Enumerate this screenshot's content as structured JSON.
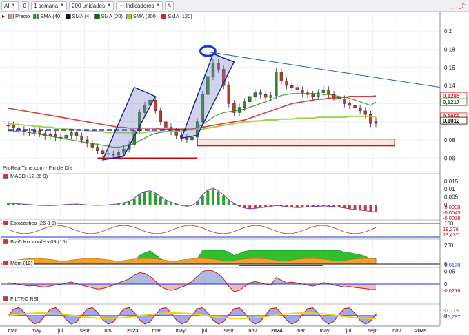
{
  "toolbar": {
    "symbol": "AI",
    "interval": "1 semana",
    "units": "200 unidades",
    "indicators": "Indicadores",
    "zero_btn": "0"
  },
  "legend": [
    {
      "label": "Precio",
      "color": "#f08a8a"
    },
    {
      "label": "SMA (40)",
      "color": "#2e8b2e"
    },
    {
      "label": "SMA (4)",
      "color": "#111111"
    },
    {
      "label": "SMA (20)",
      "color": "#1f5f1f"
    },
    {
      "label": "SMA (200)",
      "color": "#9acd32"
    },
    {
      "label": "SMA (120)",
      "color": "#d62728"
    }
  ],
  "source_text": "ProRealTime.com - Fin de Día",
  "x_axis_labels": [
    "mar",
    "may",
    "jul",
    "sept",
    "nov",
    "2023",
    "mar",
    "may",
    "jul",
    "sept",
    "nov",
    "2024",
    "mar",
    "may",
    "jul",
    "sept",
    "nov",
    "2025"
  ],
  "chart_data": [
    {
      "type": "line",
      "title": "",
      "y_ticks": [
        "0,2",
        "0,18",
        "0,16",
        "0,14",
        "0,12",
        "0,1",
        "0,08",
        "0,06"
      ],
      "ylim": [
        0.045,
        0.21
      ],
      "price_labels": [
        {
          "text": "0,1285",
          "color": "#d62728"
        },
        {
          "text": "0,1217",
          "color": "#1f5f1f"
        },
        {
          "text": "0,1059",
          "color": "#d62728"
        },
        {
          "text": "0,1012",
          "color": "#111111"
        }
      ],
      "series": [
        {
          "name": "Precio",
          "color": "#2e8b2e",
          "values": [
            0.096,
            0.093,
            0.091,
            0.089,
            0.088,
            0.09,
            0.087,
            0.084,
            0.086,
            0.083,
            0.082,
            0.085,
            0.088,
            0.084,
            0.08,
            0.076,
            0.072,
            0.068,
            0.065,
            0.064,
            0.063,
            0.066,
            0.07,
            0.075,
            0.09,
            0.11,
            0.118,
            0.124,
            0.112,
            0.1,
            0.094,
            0.089,
            0.085,
            0.082,
            0.08,
            0.083,
            0.1,
            0.13,
            0.15,
            0.165,
            0.158,
            0.14,
            0.12,
            0.11,
            0.116,
            0.122,
            0.128,
            0.132,
            0.13,
            0.127,
            0.129,
            0.155,
            0.145,
            0.14,
            0.138,
            0.135,
            0.132,
            0.13,
            0.128,
            0.132,
            0.135,
            0.13,
            0.127,
            0.125,
            0.12,
            0.118,
            0.115,
            0.112,
            0.108,
            0.098,
            0.101
          ]
        },
        {
          "name": "SMA (40)",
          "color": "#2e8b2e",
          "values": [
            0.09,
            0.09,
            0.089,
            0.089,
            0.088,
            0.087,
            0.086,
            0.085,
            0.084,
            0.083,
            0.082,
            0.081,
            0.08,
            0.079,
            0.078,
            0.077,
            0.076,
            0.075,
            0.074,
            0.073,
            0.072,
            0.072,
            0.073,
            0.074,
            0.076,
            0.079,
            0.082,
            0.085,
            0.087,
            0.088,
            0.089,
            0.089,
            0.09,
            0.09,
            0.091,
            0.092,
            0.094,
            0.097,
            0.101,
            0.105,
            0.108,
            0.11,
            0.111,
            0.112,
            0.113,
            0.114,
            0.116,
            0.118,
            0.12,
            0.122,
            0.124,
            0.127,
            0.129,
            0.13,
            0.131,
            0.131,
            0.131,
            0.131,
            0.131,
            0.131,
            0.13,
            0.13,
            0.129,
            0.128,
            0.127,
            0.126,
            0.124,
            0.122,
            0.12,
            0.118,
            0.1217
          ]
        },
        {
          "name": "SMA (120)",
          "color": "#d62728",
          "values": [
            0.115,
            0.114,
            0.113,
            0.112,
            0.111,
            0.11,
            0.109,
            0.108,
            0.107,
            0.106,
            0.105,
            0.104,
            0.103,
            0.102,
            0.101,
            0.1,
            0.099,
            0.098,
            0.097,
            0.096,
            0.095,
            0.094,
            0.094,
            0.093,
            0.093,
            0.093,
            0.093,
            0.093,
            0.093,
            0.092,
            0.092,
            0.092,
            0.092,
            0.092,
            0.092,
            0.092,
            0.093,
            0.094,
            0.095,
            0.096,
            0.097,
            0.098,
            0.099,
            0.1,
            0.101,
            0.102,
            0.104,
            0.106,
            0.108,
            0.11,
            0.112,
            0.114,
            0.116,
            0.118,
            0.12,
            0.121,
            0.122,
            0.123,
            0.124,
            0.125,
            0.125,
            0.126,
            0.126,
            0.127,
            0.127,
            0.128,
            0.128,
            0.128,
            0.128,
            0.128,
            0.1285
          ]
        },
        {
          "name": "SMA (200)",
          "color": "#9acd32",
          "values": [
            0.098,
            0.097,
            0.097,
            0.096,
            0.096,
            0.095,
            0.095,
            0.094,
            0.094,
            0.093,
            0.093,
            0.092,
            0.092,
            0.091,
            0.091,
            0.09,
            0.09,
            0.089,
            0.089,
            0.088,
            0.088,
            0.088,
            0.088,
            0.088,
            0.088,
            0.088,
            0.088,
            0.089,
            0.089,
            0.089,
            0.089,
            0.09,
            0.09,
            0.09,
            0.091,
            0.091,
            0.092,
            0.092,
            0.093,
            0.094,
            0.095,
            0.096,
            0.097,
            0.098,
            0.099,
            0.1,
            0.1,
            0.101,
            0.101,
            0.102,
            0.102,
            0.102,
            0.103,
            0.103,
            0.103,
            0.104,
            0.104,
            0.104,
            0.104,
            0.105,
            0.105,
            0.105,
            0.105,
            0.105,
            0.105,
            0.106,
            0.106,
            0.106,
            0.106,
            0.106,
            0.1059
          ]
        }
      ]
    },
    {
      "type": "bar",
      "title": "MACD (12 26 9)",
      "y_ticks": [
        "0,015",
        "0,01",
        "0,005",
        "0"
      ],
      "last_values": [
        "-0,0038",
        "-0,0043",
        "-0,0078"
      ],
      "values": [
        0.001,
        0.0008,
        0.0005,
        0.0003,
        0.0001,
        -0.0002,
        -0.0004,
        -0.0005,
        -0.0006,
        -0.0004,
        -0.0002,
        0.0001,
        0.0003,
        0.0004,
        0.0002,
        -0.0001,
        -0.0003,
        -0.0004,
        -0.0003,
        -0.0001,
        0.0002,
        0.0006,
        0.0012,
        0.002,
        0.004,
        0.0065,
        0.008,
        0.0085,
        0.0072,
        0.005,
        0.003,
        0.0015,
        0.0005,
        -0.0005,
        -0.001,
        -0.0005,
        0.002,
        0.006,
        0.009,
        0.01,
        0.0085,
        0.006,
        0.003,
        0.0008,
        -0.001,
        -0.002,
        -0.0025,
        -0.0022,
        -0.0018,
        -0.0015,
        -0.001,
        -0.0005,
        -0.0008,
        -0.0012,
        -0.0015,
        -0.0018,
        -0.0016,
        -0.0014,
        -0.0012,
        -0.001,
        -0.0008,
        -0.001,
        -0.0012,
        -0.0015,
        -0.002,
        -0.0025,
        -0.003,
        -0.0033,
        -0.0036,
        -0.004,
        -0.0043
      ]
    },
    {
      "type": "line",
      "title": "Estocástico (26 8 5)",
      "y_ticks": [
        "100"
      ],
      "last_values": [
        "19,276",
        "13,437"
      ],
      "values": []
    },
    {
      "type": "area",
      "title": "Blai5 Koncorde v.09 (15)",
      "y_ticks": [
        "200",
        "0"
      ],
      "last_values": [
        "-5,0178"
      ],
      "values": []
    },
    {
      "type": "area",
      "title": "Mom (12)",
      "y_ticks": [
        "0,05",
        "0"
      ],
      "last_values": [
        "-0,0216"
      ],
      "values": [
        0.005,
        0.003,
        -0.002,
        -0.005,
        -0.008,
        -0.006,
        -0.01,
        -0.012,
        -0.008,
        -0.004,
        -0.002,
        0.004,
        0.008,
        0.002,
        -0.005,
        -0.01,
        -0.015,
        -0.02,
        -0.018,
        -0.012,
        -0.005,
        0.005,
        0.012,
        0.02,
        0.035,
        0.045,
        0.042,
        0.03,
        0.012,
        -0.01,
        -0.02,
        -0.025,
        -0.02,
        -0.012,
        -0.005,
        0.01,
        0.03,
        0.05,
        0.055,
        0.052,
        0.04,
        0.02,
        -0.01,
        -0.03,
        -0.025,
        -0.01,
        0.005,
        0.01,
        0.005,
        0.0,
        -0.005,
        0.025,
        0.015,
        0.005,
        0.008,
        0.004,
        0.0,
        -0.005,
        -0.008,
        -0.003,
        0.006,
        0.002,
        -0.004,
        -0.008,
        -0.012,
        -0.01,
        -0.014,
        -0.016,
        -0.018,
        -0.022,
        -0.0216
      ]
    },
    {
      "type": "area",
      "title": "FILTRO RSI",
      "y_ticks": [
        "0"
      ],
      "last_values": [
        "37,319",
        "-25,787"
      ],
      "values": []
    }
  ]
}
